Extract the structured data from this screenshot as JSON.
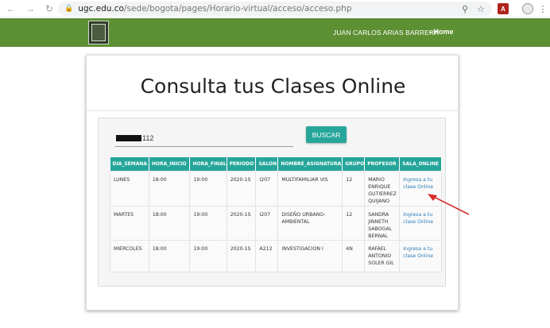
{
  "browser": {
    "url_host": "ugc.edu.co",
    "url_path": "/sede/bogota/pages/Horario-virtual/acceso/acceso.php"
  },
  "header": {
    "user_name": "JUAN CARLOS ARIAS BARRERA",
    "home_label": "- Home"
  },
  "page": {
    "title": "Consulta tus Clases Online",
    "code_suffix": "112",
    "search_button": "BUSCAR"
  },
  "table": {
    "columns": [
      "DIA_SEMANA",
      "HORA_INICIO",
      "HORA_FINAL",
      "PERIODO",
      "SALON",
      "NOMBRE_ASIGNATURA",
      "GRUPO",
      "PROFESOR",
      "SALA_ONLINE"
    ],
    "rows": [
      {
        "dia": "LUNES",
        "inicio": "18:00",
        "final": "19:00",
        "periodo": "2020-1S",
        "salon": "I207",
        "asignatura": "MULTIFAMILIAR VIS",
        "grupo": "12",
        "profesor": "MARIO ENRIQUE GUTIERREZ QUIJANO",
        "sala": "Ingresa a tu clase Online"
      },
      {
        "dia": "MARTES",
        "inicio": "18:00",
        "final": "19:00",
        "periodo": "2020-1S",
        "salon": "I207",
        "asignatura": "DISEÑO URBANO-AMBIENTAL",
        "grupo": "12",
        "profesor": "SANDRA JINNETH SABOGAL BERNAL",
        "sala": "Ingresa a tu clase Online"
      },
      {
        "dia": "MIERCOLES",
        "inicio": "18:00",
        "final": "19:00",
        "periodo": "2020-1S",
        "salon": "A212",
        "asignatura": "INVESTIGACION I",
        "grupo": "4N",
        "profesor": "RAFAEL ANTONIO SOLER GIL",
        "sala": "Ingresa a tu clase Online"
      }
    ]
  },
  "colors": {
    "header_green": "#5d8f33",
    "teal": "#26a69a",
    "arrow_red": "#d62b2b",
    "link_blue": "#2a7bb7"
  },
  "icons": [
    "back-arrow-icon",
    "forward-arrow-icon",
    "reload-icon",
    "lock-icon",
    "zoom-icon",
    "star-icon",
    "pdf-icon",
    "profile-icon",
    "menu-icon",
    "university-logo"
  ]
}
